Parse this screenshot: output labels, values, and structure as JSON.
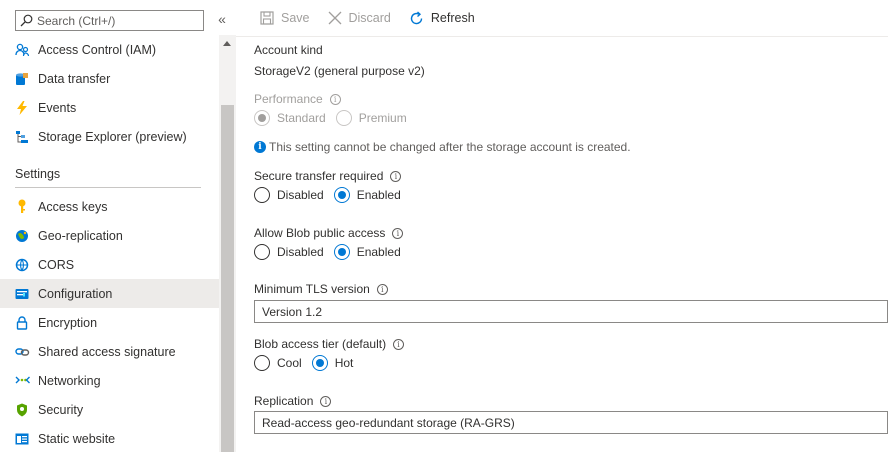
{
  "sidebar": {
    "search_placeholder": "Search (Ctrl+/)",
    "collapse_glyph": "«",
    "items_top": [
      {
        "label": "Access Control (IAM)",
        "icon": "people-icon"
      },
      {
        "label": "Data transfer",
        "icon": "data-transfer-icon"
      },
      {
        "label": "Events",
        "icon": "lightning-icon"
      },
      {
        "label": "Storage Explorer (preview)",
        "icon": "storage-explorer-icon"
      }
    ],
    "section_settings": "Settings",
    "items_settings": [
      {
        "label": "Access keys",
        "icon": "key-icon"
      },
      {
        "label": "Geo-replication",
        "icon": "globe-icon"
      },
      {
        "label": "CORS",
        "icon": "cors-icon"
      },
      {
        "label": "Configuration",
        "icon": "configuration-icon",
        "selected": true
      },
      {
        "label": "Encryption",
        "icon": "lock-icon"
      },
      {
        "label": "Shared access signature",
        "icon": "link-icon"
      },
      {
        "label": "Networking",
        "icon": "networking-icon"
      },
      {
        "label": "Security",
        "icon": "shield-icon"
      },
      {
        "label": "Static website",
        "icon": "static-website-icon"
      }
    ]
  },
  "toolbar": {
    "save_label": "Save",
    "discard_label": "Discard",
    "refresh_label": "Refresh"
  },
  "config": {
    "account_kind_label": "Account kind",
    "account_kind_value": "StorageV2 (general purpose v2)",
    "performance_label": "Performance",
    "performance_options": [
      "Standard",
      "Premium"
    ],
    "performance_selected": "Standard",
    "performance_notice": "This setting cannot be changed after the storage account is created.",
    "secure_transfer_label": "Secure transfer required",
    "secure_transfer_options": [
      "Disabled",
      "Enabled"
    ],
    "secure_transfer_selected": "Enabled",
    "blob_public_label": "Allow Blob public access",
    "blob_public_options": [
      "Disabled",
      "Enabled"
    ],
    "blob_public_selected": "Enabled",
    "tls_label": "Minimum TLS version",
    "tls_value": "Version 1.2",
    "blob_tier_label": "Blob access tier (default)",
    "blob_tier_options": [
      "Cool",
      "Hot"
    ],
    "blob_tier_selected": "Hot",
    "replication_label": "Replication",
    "replication_value": "Read-access geo-redundant storage (RA-GRS)"
  },
  "colors": {
    "accent": "#0078d4",
    "selected_bg": "#edebe9",
    "disabled_text": "#a19f9d"
  }
}
